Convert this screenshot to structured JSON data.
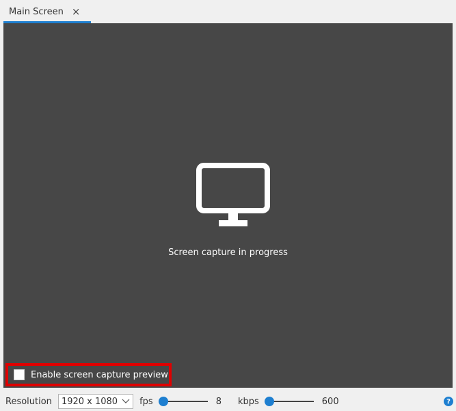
{
  "tab": {
    "label": "Main Screen",
    "close_icon": "×"
  },
  "preview": {
    "icon": "monitor-icon",
    "status_text": "Screen capture in progress",
    "enable_preview_label": "Enable screen capture preview",
    "enable_preview_checked": false
  },
  "statusbar": {
    "resolution_label": "Resolution",
    "resolution_value": "1920 x 1080",
    "fps_label": "fps",
    "fps_value": "8",
    "fps_fraction": 0.1,
    "kbps_label": "kbps",
    "kbps_value": "600",
    "kbps_fraction": 0.1,
    "help_icon": "?"
  },
  "colors": {
    "accent": "#1e7fd0",
    "preview_bg": "#474747",
    "highlight": "#e00000"
  }
}
